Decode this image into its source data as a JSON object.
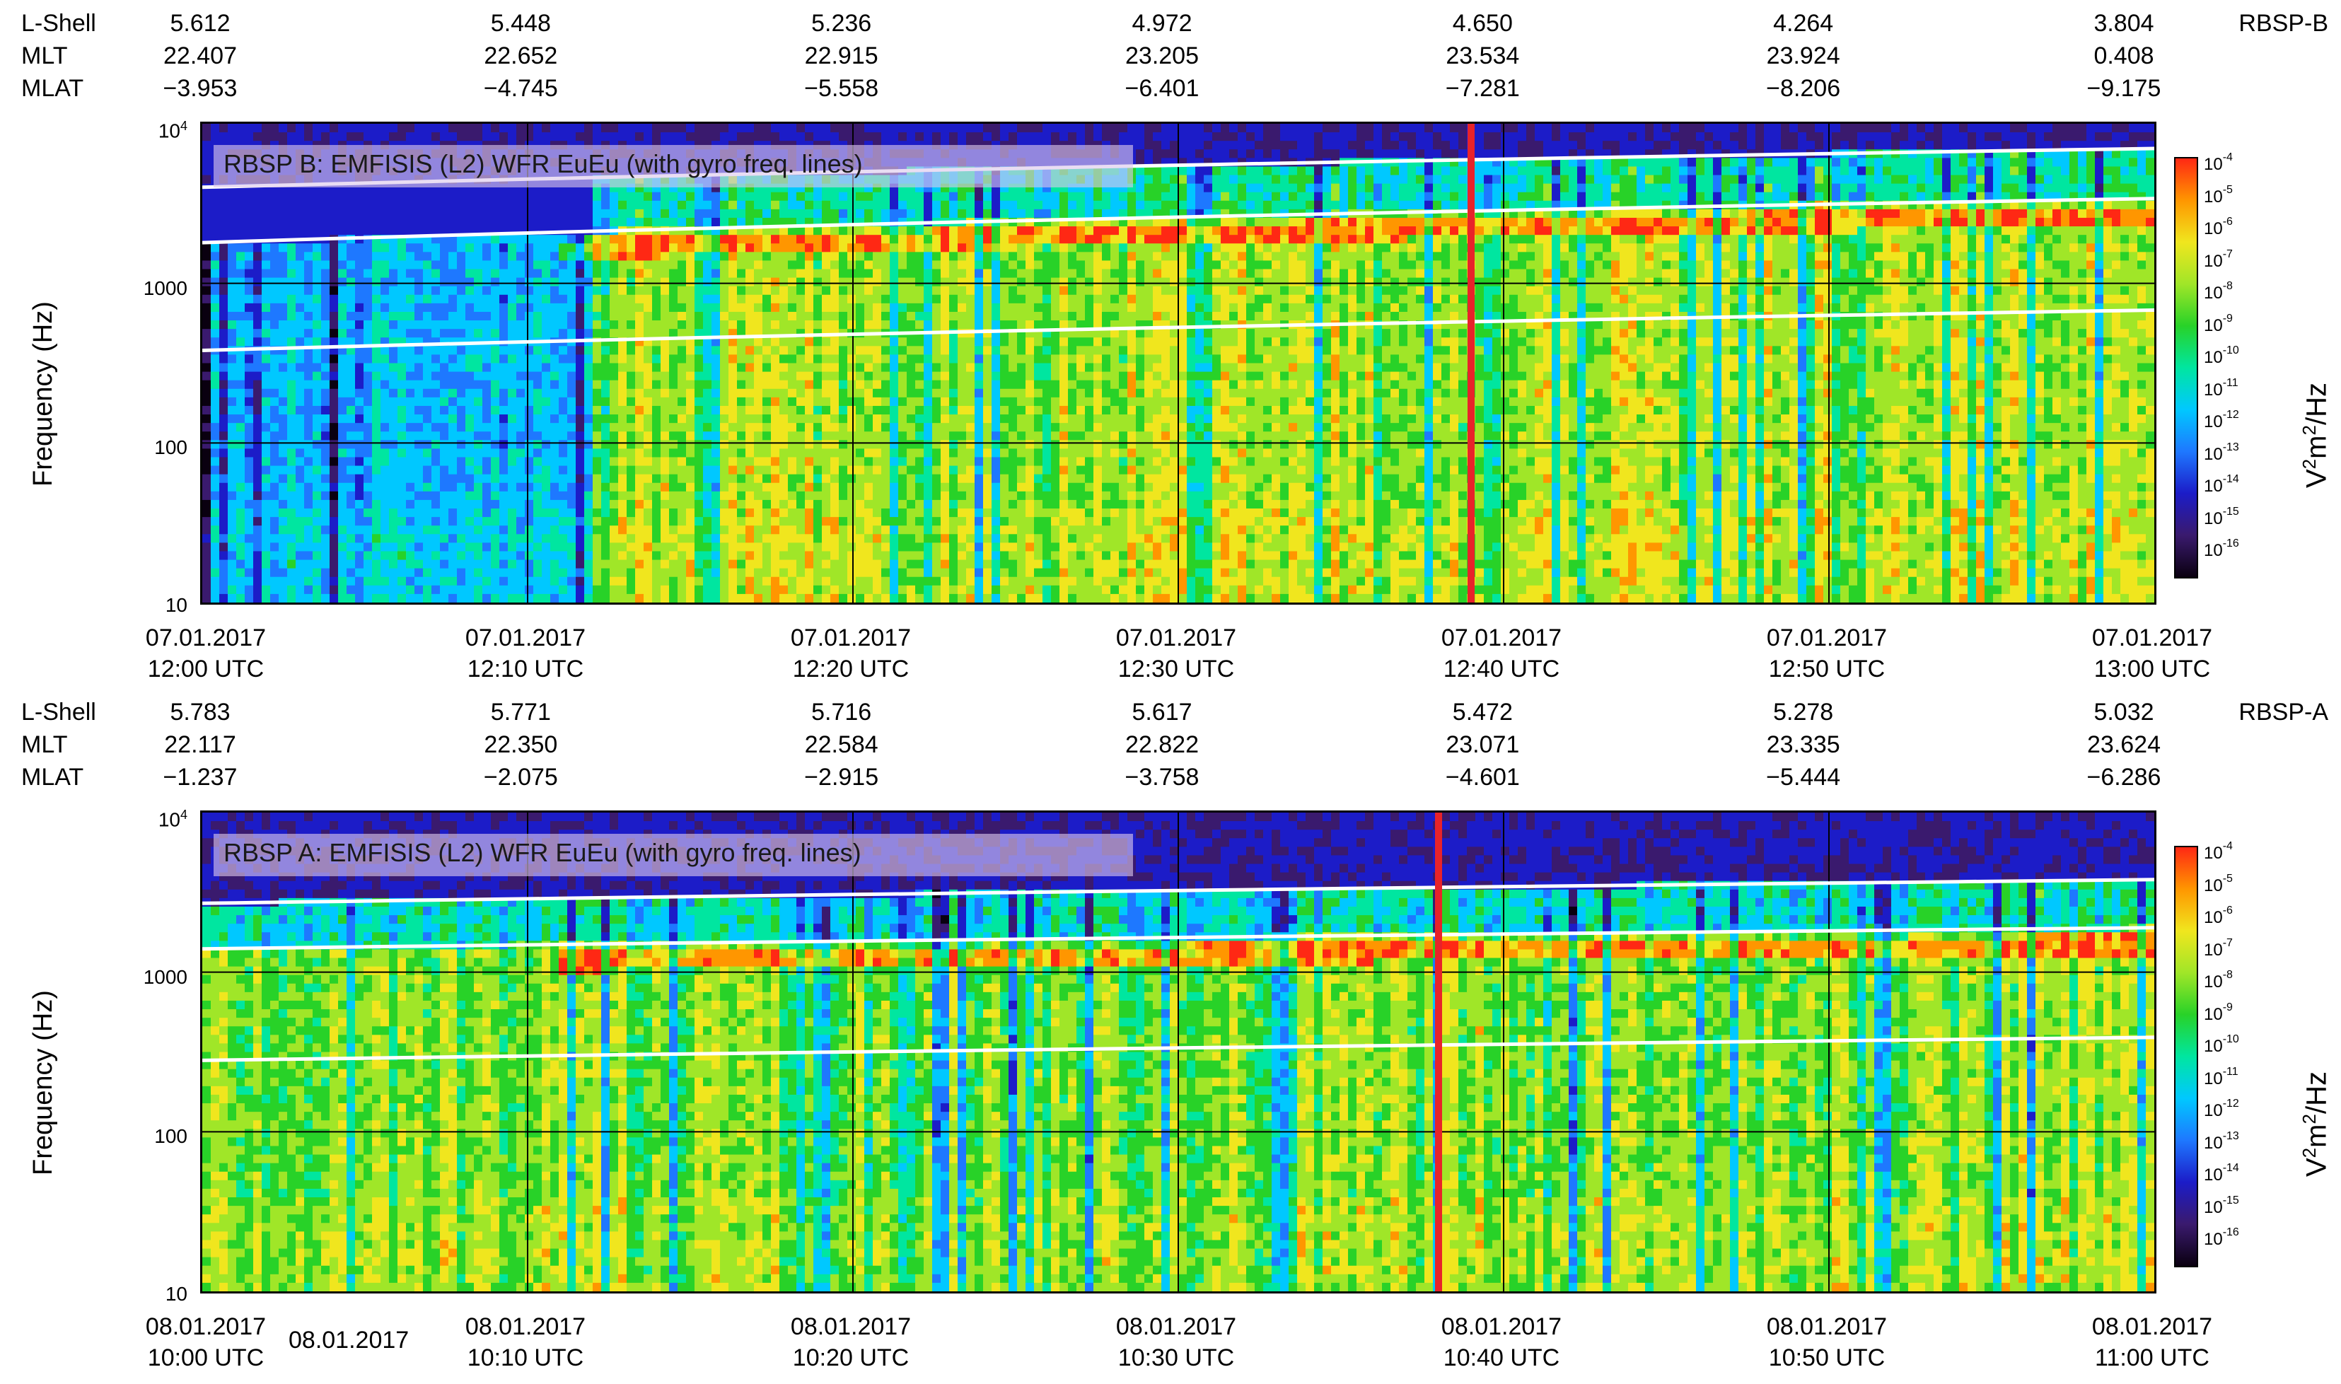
{
  "colors": {
    "colormap": [
      "#0a0010",
      "#3a1a6e",
      "#1c1cc8",
      "#1e78ff",
      "#00c8ff",
      "#00e6a0",
      "#28d228",
      "#a0e628",
      "#f0e61e",
      "#ff9600",
      "#ff2814"
    ],
    "background_purple": "#2a1a5e",
    "cursor_line": "#e8232a",
    "gyro_lines": "#ffffff",
    "grid": "#000000"
  },
  "panels": [
    {
      "id": "top",
      "spacecraft": "RBSP-B",
      "ephemeris": {
        "labels": [
          "L-Shell",
          "MLT",
          "MLAT"
        ],
        "lshell": [
          "5.612",
          "5.448",
          "5.236",
          "4.972",
          "4.650",
          "4.264",
          "3.804"
        ],
        "mlt": [
          "22.407",
          "22.652",
          "22.915",
          "23.205",
          "23.534",
          "23.924",
          "0.408"
        ],
        "mlat": [
          "−3.953",
          "−4.745",
          "−5.558",
          "−6.401",
          "−7.281",
          "−8.206",
          "−9.175"
        ]
      },
      "title": "RBSP B: EMFISIS (L2) WFR EuEu (with gyro freq. lines)",
      "ylabel": "Frequency (Hz)",
      "yticks": [
        "10",
        "100",
        "1000",
        "10"
      ],
      "xtick_dates": [
        "07.01.2017",
        "07.01.2017",
        "07.01.2017",
        "07.01.2017",
        "07.01.2017",
        "07.01.2017",
        "07.01.2017"
      ],
      "xtick_times": [
        "12:00 UTC",
        "12:10 UTC",
        "12:20 UTC",
        "12:30 UTC",
        "12:40 UTC",
        "12:50 UTC",
        "13:00 UTC"
      ],
      "extra_tick": ""
    },
    {
      "id": "bottom",
      "spacecraft": "RBSP-A",
      "ephemeris": {
        "labels": [
          "L-Shell",
          "MLT",
          "MLAT"
        ],
        "lshell": [
          "5.783",
          "5.771",
          "5.716",
          "5.617",
          "5.472",
          "5.278",
          "5.032"
        ],
        "mlt": [
          "22.117",
          "22.350",
          "22.584",
          "22.822",
          "23.071",
          "23.335",
          "23.624"
        ],
        "mlat": [
          "−1.237",
          "−2.075",
          "−2.915",
          "−3.758",
          "−4.601",
          "−5.444",
          "−6.286"
        ]
      },
      "title": "RBSP A: EMFISIS (L2) WFR EuEu (with gyro freq. lines)",
      "ylabel": "Frequency (Hz)",
      "yticks": [
        "10",
        "100",
        "1000",
        "10"
      ],
      "xtick_dates": [
        "08.01.2017",
        "08.01.2017",
        "08.01.2017",
        "08.01.2017",
        "08.01.2017",
        "08.01.2017",
        "08.01.2017"
      ],
      "xtick_times": [
        "10:00 UTC",
        "10:10 UTC",
        "10:20 UTC",
        "10:30 UTC",
        "10:40 UTC",
        "10:50 UTC",
        "11:00 UTC"
      ],
      "extra_tick": "08.01.2017"
    }
  ],
  "colorbar": {
    "exponents": [
      "-4",
      "-5",
      "-6",
      "-7",
      "-8",
      "-9",
      "-10",
      "-11",
      "-12",
      "-13",
      "-14",
      "-15",
      "-16"
    ],
    "base": "10",
    "label_main": "V",
    "label_sup": "2",
    "label_mid": "m",
    "label_sup2": "2",
    "label_end": "/Hz"
  },
  "chart_data": [
    {
      "type": "heatmap",
      "title": "RBSP B: EMFISIS (L2) WFR EuEu (with gyro freq. lines)",
      "xlabel": "",
      "ylabel": "Frequency (Hz)",
      "x_range": [
        "07.01.2017 12:00 UTC",
        "07.01.2017 13:00 UTC"
      ],
      "y_range": [
        10,
        10000
      ],
      "y_scale": "log",
      "z_label": "V2m2/Hz",
      "z_range": [
        1e-16,
        0.0001
      ],
      "gyro_lines_hz": {
        "fce": {
          "x_min": [
            0,
            60
          ],
          "y": [
            4000,
            7000
          ]
        },
        "half_fce": {
          "x_min": [
            0,
            60
          ],
          "y": [
            1800,
            3400
          ]
        },
        "tenth_fce": {
          "x_min": [
            0,
            60
          ],
          "y": [
            380,
            680
          ]
        }
      },
      "cursor_time": "12:39 UTC",
      "grid": true
    },
    {
      "type": "heatmap",
      "title": "RBSP A: EMFISIS (L2) WFR EuEu (with gyro freq. lines)",
      "xlabel": "",
      "ylabel": "Frequency (Hz)",
      "x_range": [
        "08.01.2017 10:00 UTC",
        "08.01.2017 11:00 UTC"
      ],
      "y_range": [
        10,
        10000
      ],
      "y_scale": "log",
      "z_label": "V2m2/Hz",
      "z_range": [
        1e-16,
        0.0001
      ],
      "gyro_lines_hz": {
        "fce": {
          "x_min": [
            0,
            60
          ],
          "y": [
            2700,
            3800
          ]
        },
        "half_fce": {
          "x_min": [
            0,
            60
          ],
          "y": [
            1400,
            1900
          ]
        },
        "tenth_fce": {
          "x_min": [
            0,
            60
          ],
          "y": [
            280,
            390
          ]
        }
      },
      "cursor_time": "10:38 UTC",
      "grid": true
    }
  ]
}
